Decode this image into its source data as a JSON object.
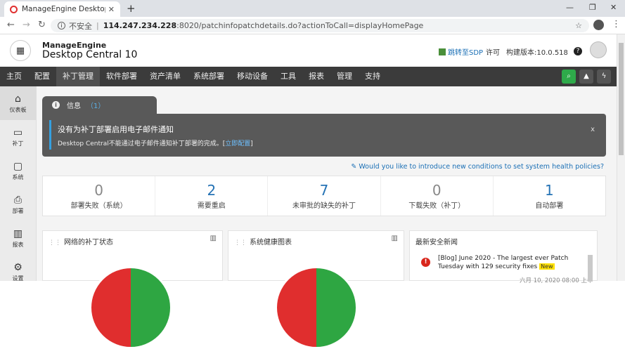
{
  "browser": {
    "tab_title": "ManageEngine Desktop Centra",
    "new_tab": "+",
    "win_min": "—",
    "win_max": "❐",
    "win_close": "✕",
    "not_secure": "不安全",
    "url_host": "114.247.234.228",
    "url_rest": ":8020/patchinfopatchdetails.do?actionToCall=displayHomePage"
  },
  "header": {
    "logo_top": "ManageEngine",
    "logo_bottom": "Desktop Central 10",
    "sdp_link": "跳转至SDP",
    "license": "许可",
    "build": "构建版本:10.0.518",
    "help": "?"
  },
  "nav": {
    "items": [
      "主页",
      "配置",
      "补丁管理",
      "软件部署",
      "资产清单",
      "系统部署",
      "移动设备",
      "工具",
      "报表",
      "管理",
      "支持"
    ],
    "active_index": 2
  },
  "sidebar": {
    "items": [
      {
        "label": "仪表板",
        "icon": "home-icon"
      },
      {
        "label": "补丁",
        "icon": "patch-icon"
      },
      {
        "label": "系统",
        "icon": "monitor-icon"
      },
      {
        "label": "部署",
        "icon": "deploy-icon"
      },
      {
        "label": "报表",
        "icon": "report-icon"
      },
      {
        "label": "设置",
        "icon": "gear-icon"
      }
    ]
  },
  "info": {
    "tab_label": "信息",
    "tab_count": "（1）",
    "heading": "没有为补丁部署启用电子邮件通知",
    "desc_prefix": "Desktop Central不能通过电子邮件通知补丁部署的完成。[",
    "desc_link": "立即配置",
    "desc_suffix": "]",
    "close": "x"
  },
  "health_link": "Would you like to introduce new conditions to set system health policies?",
  "stats": [
    {
      "value": "0",
      "label": "部署失败（系统）",
      "color": "#888888"
    },
    {
      "value": "2",
      "label": "需要重启",
      "color": "#2673b5"
    },
    {
      "value": "7",
      "label": "未审批的缺失的补丁",
      "color": "#2673b5"
    },
    {
      "value": "0",
      "label": "下载失败（补丁）",
      "color": "#888888"
    },
    {
      "value": "1",
      "label": "自动部署",
      "color": "#2673b5"
    }
  ],
  "widgets": {
    "patch_status": "网络的补丁状态",
    "health_chart": "系统健康图表",
    "news_title": "最新安全新闻",
    "news_text": "[Blog] June 2020 - The largest ever Patch Tuesday with 129 security fixes",
    "news_badge": "New",
    "news_date": "六月 10, 2020 08:00 上午"
  }
}
